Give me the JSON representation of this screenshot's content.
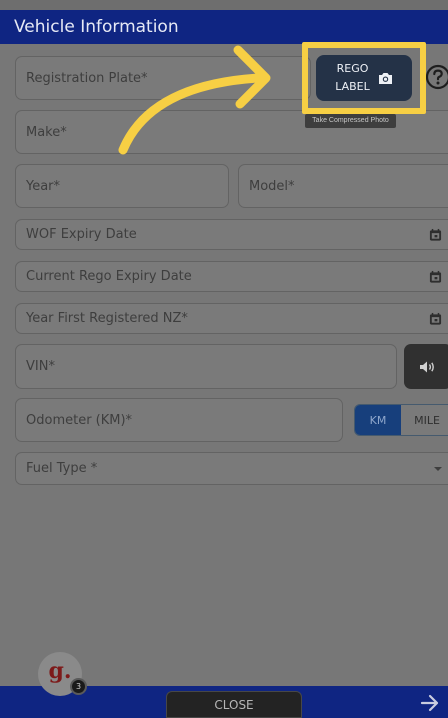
{
  "header": {
    "title": "Vehicle Information"
  },
  "fields": {
    "registration_plate": "Registration Plate*",
    "make": "Make*",
    "year": "Year*",
    "model": "Model*",
    "wof_expiry": "WOF Expiry Date",
    "rego_expiry": "Current Rego Expiry Date",
    "first_registered": "Year First Registered NZ*",
    "vin": "VIN*",
    "odometer": "Odometer (KM)*",
    "fuel_type": "Fuel Type *"
  },
  "rego_button": {
    "line1": "REGO",
    "line2": "LABEL",
    "tooltip": "Take Compressed Photo"
  },
  "unit_toggle": {
    "km": "KM",
    "mile": "MILE",
    "selected": "KM"
  },
  "footer": {
    "close_label": "CLOSE"
  },
  "avatar": {
    "letter": "g.",
    "badge_count": "3"
  },
  "icons": {
    "help": "help-circle-icon",
    "camera": "camera-icon",
    "calendar": "calendar-icon",
    "speaker": "speaker-icon",
    "dropdown": "caret-down-icon",
    "next": "arrow-right-icon"
  },
  "colors": {
    "header_bg": "#0f2582",
    "highlight": "#f7cf44",
    "toggle_active": "#173f7c"
  }
}
